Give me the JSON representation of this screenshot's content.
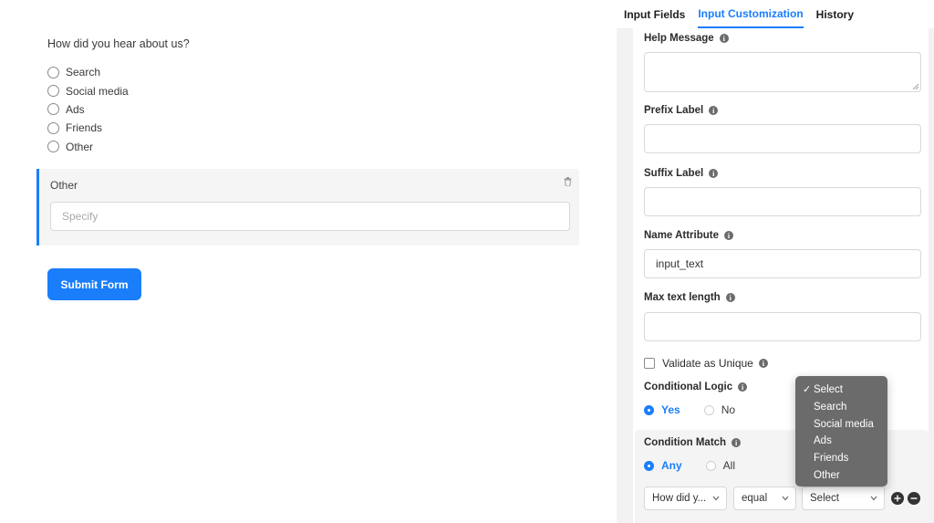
{
  "form": {
    "question": "How did you hear about us?",
    "options": [
      "Search",
      "Social media",
      "Ads",
      "Friends",
      "Other"
    ],
    "other_block": {
      "title": "Other",
      "placeholder": "Specify"
    },
    "submit_label": "Submit Form"
  },
  "tabs": [
    "Input Fields",
    "Input Customization",
    "History"
  ],
  "active_tab": "Input Customization",
  "settings": {
    "help_message": {
      "label": "Help Message",
      "value": ""
    },
    "prefix_label": {
      "label": "Prefix Label",
      "value": ""
    },
    "suffix_label": {
      "label": "Suffix Label",
      "value": ""
    },
    "name_attribute": {
      "label": "Name Attribute",
      "value": "input_text"
    },
    "max_text_length": {
      "label": "Max text length",
      "value": ""
    },
    "validate_unique": {
      "label": "Validate as Unique",
      "checked": false
    },
    "conditional_logic": {
      "label": "Conditional Logic",
      "yes": "Yes",
      "no": "No",
      "selected": "Yes"
    },
    "condition_match": {
      "label": "Condition Match",
      "any": "Any",
      "all": "All",
      "selected": "Any"
    },
    "rule": {
      "field": "How did y...",
      "operator": "equal",
      "value": "Select"
    }
  },
  "dropdown": {
    "selected": "Select",
    "options": [
      "Select",
      "Search",
      "Social media",
      "Ads",
      "Friends",
      "Other"
    ]
  },
  "colors": {
    "accent": "#1a7efb",
    "panel_gutter": "#f2f2f2",
    "dropdown_bg": "#6b6b6b"
  }
}
